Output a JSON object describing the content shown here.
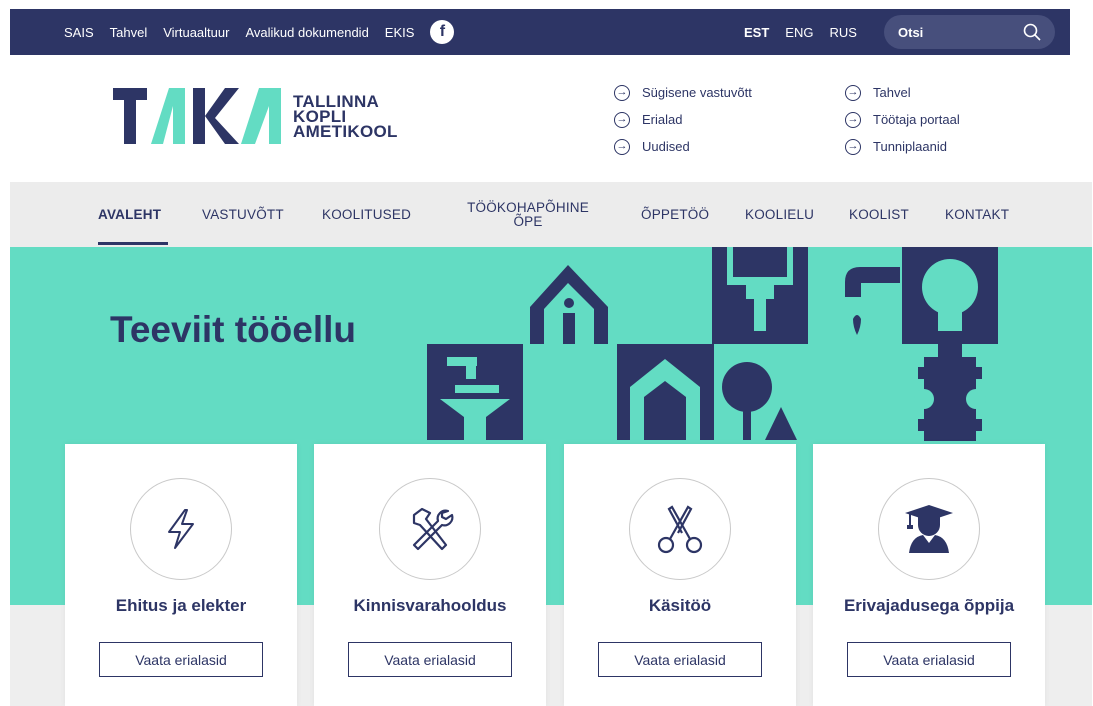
{
  "topbar": {
    "links": [
      "SAIS",
      "Tahvel",
      "Virtuaaltuur",
      "Avalikud dokumendid",
      "EKIS"
    ],
    "facebook_glyph": "f",
    "languages": [
      "EST",
      "ENG",
      "RUS"
    ],
    "active_language": "EST",
    "search_placeholder": "Otsi"
  },
  "logo": {
    "mark": "TAKA",
    "line1": "TALLINNA",
    "line2": "KOPLI",
    "line3": "AMETIKOOL"
  },
  "quicklinks": {
    "col1": [
      "Sügisene vastuvõtt",
      "Erialad",
      "Uudised"
    ],
    "col2": [
      "Tahvel",
      "Töötaja portaal",
      "Tunniplaanid"
    ]
  },
  "nav": {
    "items": [
      "AVALEHT",
      "VASTUVÕTT",
      "KOOLITUSED",
      "TÖÖKOHAPÕHINE ÕPE",
      "ÕPPETÖÖ",
      "KOOLIELU",
      "KOOLIST",
      "KONTAKT"
    ],
    "active": "AVALEHT"
  },
  "hero": {
    "title": "Teeviit tööellu"
  },
  "cards": [
    {
      "title": "Ehitus ja elekter",
      "button": "Vaata erialasid",
      "icon": "lightning-icon"
    },
    {
      "title": "Kinnisvarahooldus",
      "button": "Vaata erialasid",
      "icon": "tools-icon"
    },
    {
      "title": "Käsitöö",
      "button": "Vaata erialasid",
      "icon": "scissors-icon"
    },
    {
      "title": "Erivajadusega õppija",
      "button": "Vaata erialasid",
      "icon": "graduate-icon"
    }
  ],
  "colors": {
    "navy": "#2d3565",
    "mint": "#63dcc3",
    "nav_bg": "#ececec"
  }
}
